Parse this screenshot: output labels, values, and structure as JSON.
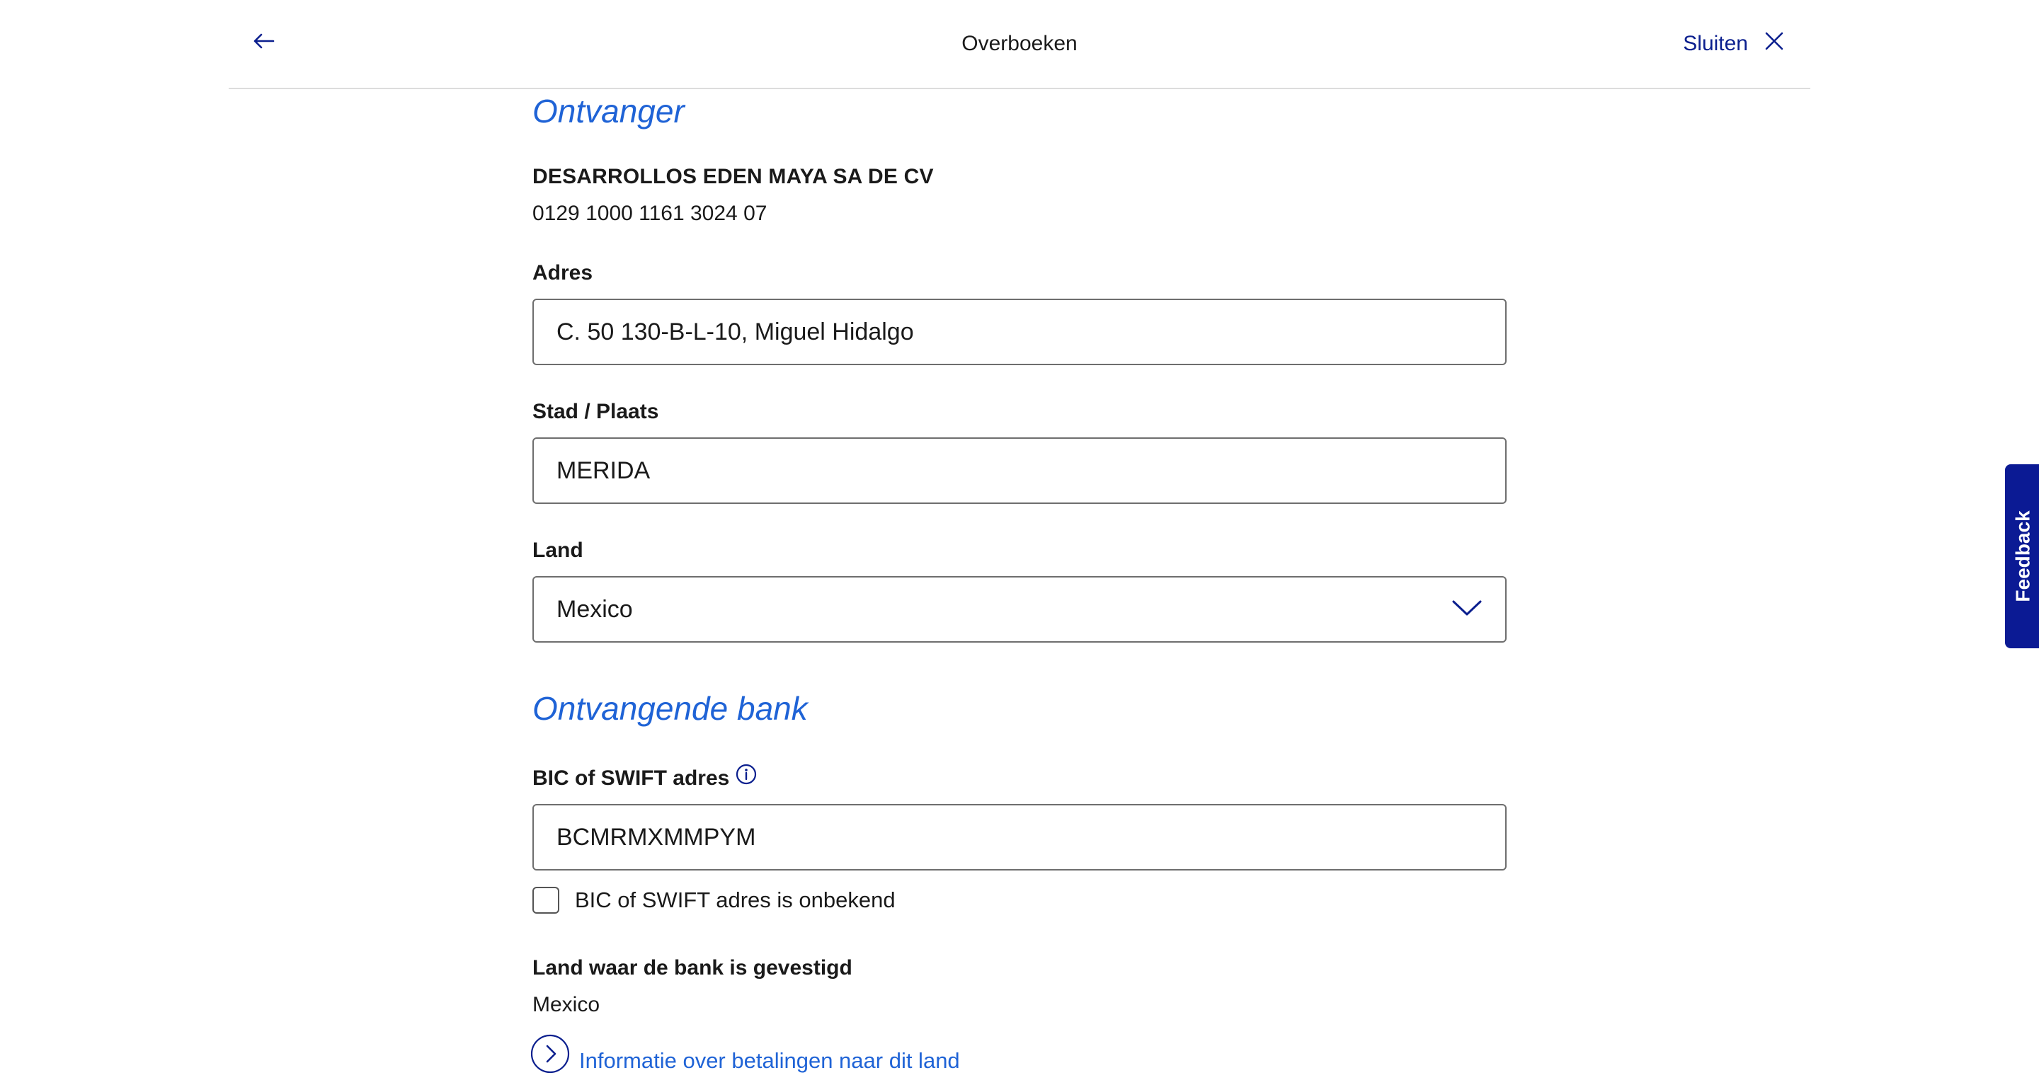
{
  "header": {
    "title": "Overboeken",
    "close_label": "Sluiten"
  },
  "recipient": {
    "section_title": "Ontvanger",
    "name": "DESARROLLOS EDEN MAYA SA DE CV",
    "account": "0129 1000 1161 3024 07",
    "address_label": "Adres",
    "address_value": "C. 50 130-B-L-10, Miguel Hidalgo",
    "city_label": "Stad / Plaats",
    "city_value": "MERIDA",
    "country_label": "Land",
    "country_value": "Mexico"
  },
  "bank": {
    "section_title": "Ontvangende bank",
    "bic_label": "BIC of SWIFT adres",
    "bic_value": "BCMRMXMMPYM",
    "bic_unknown_label": "BIC of SWIFT adres is onbekend",
    "bank_country_label": "Land waar de bank is gevestigd",
    "bank_country_value": "Mexico",
    "info_link_label": "Informatie over betalingen naar dit land"
  },
  "feedback": {
    "label": "Feedback"
  },
  "colors": {
    "accent_blue": "#1f63d6",
    "navy": "#0b1f8e",
    "feedback_bg": "#0b1a94",
    "field_border": "#6e6e6e"
  },
  "icons": {
    "back": "arrow-left-icon",
    "close": "close-icon",
    "dropdown": "chevron-down-icon",
    "info": "info-icon",
    "link": "chevron-right-circle-icon"
  }
}
